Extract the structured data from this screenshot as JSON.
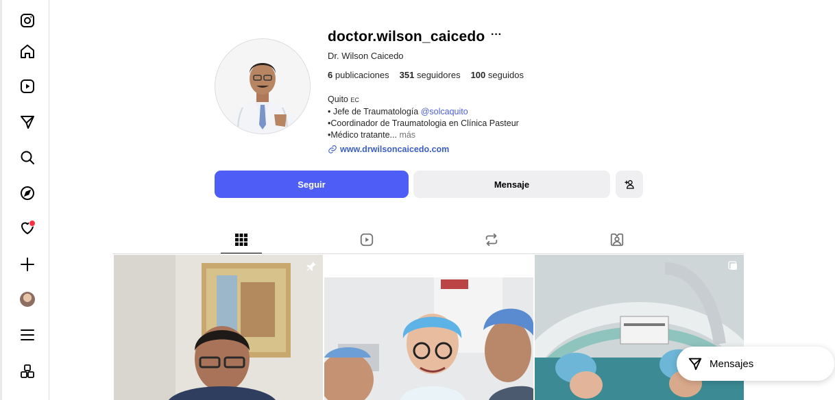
{
  "sidebar": {
    "items": [
      {
        "icon": "instagram-logo-icon"
      },
      {
        "icon": "home-icon"
      },
      {
        "icon": "reels-icon"
      },
      {
        "icon": "direct-send-icon"
      },
      {
        "icon": "search-icon"
      },
      {
        "icon": "explore-compass-icon"
      },
      {
        "icon": "heart-notifications-icon"
      },
      {
        "icon": "plus-create-icon"
      },
      {
        "icon": "avatar"
      },
      {
        "icon": "menu-icon"
      },
      {
        "icon": "more-apps-icon"
      }
    ]
  },
  "profile": {
    "username": "doctor.wilson_caicedo",
    "more": "···",
    "full_name": "Dr. Wilson Caicedo",
    "stats": {
      "posts_count": "6",
      "posts_label": "publicaciones",
      "followers_count": "351",
      "followers_label": "seguidores",
      "following_count": "100",
      "following_label": "seguidos"
    },
    "bio": {
      "line1": "Quito",
      "line1_suffix": "EC",
      "line2": "• Jefe de Traumatología ",
      "line2_mention": "@solcaquito",
      "line3": "•Coordinador de Traumatologia en Clínica Pasteur",
      "line4": "•Médico tratante...",
      "more": "más"
    },
    "website": "www.drwilsoncaicedo.com"
  },
  "actions": {
    "follow": "Seguir",
    "message": "Mensaje"
  },
  "tabs": [
    {
      "name": "posts",
      "icon": "grid-icon",
      "active": true
    },
    {
      "name": "reels",
      "icon": "reels-icon",
      "active": false
    },
    {
      "name": "reposts",
      "icon": "repost-icon",
      "active": false
    },
    {
      "name": "tagged",
      "icon": "tagged-person-icon",
      "active": false
    }
  ],
  "posts": [
    {
      "pinned": true
    },
    {
      "pinned": false
    },
    {
      "pinned": false,
      "multi": true
    }
  ],
  "messages_pill": {
    "label": "Mensajes"
  },
  "colors": {
    "accent": "#4e5df6",
    "secondary_button": "#efeff1",
    "link": "#3b5fc4",
    "notification": "#ff3040"
  }
}
